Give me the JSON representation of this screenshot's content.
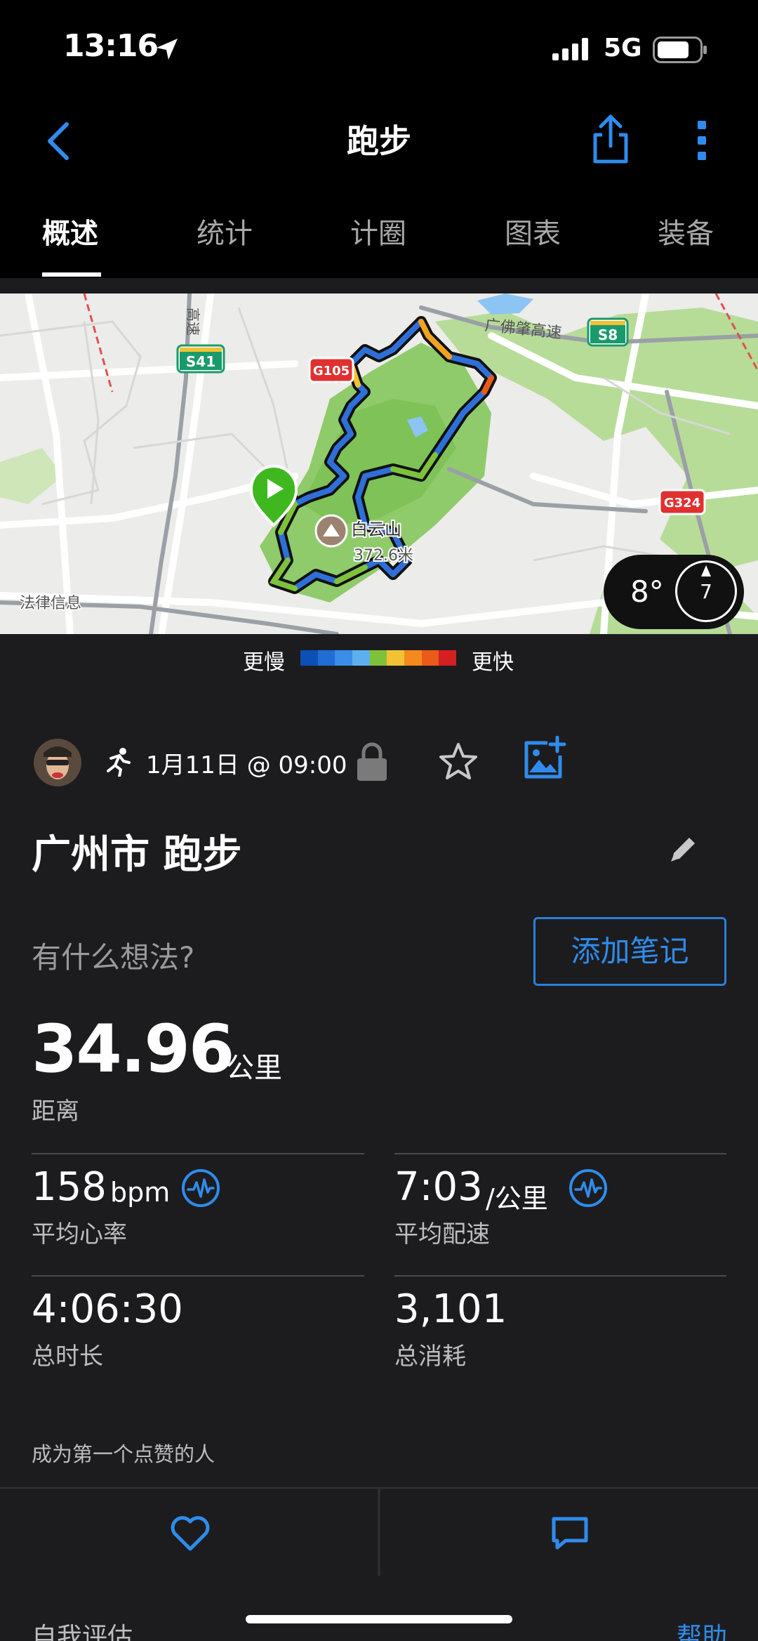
{
  "status_bar": {
    "time": "13:16",
    "network": "5G"
  },
  "nav": {
    "title": "跑步"
  },
  "tabs": [
    {
      "label": "概述",
      "active": true
    },
    {
      "label": "统计",
      "active": false
    },
    {
      "label": "计圈",
      "active": false
    },
    {
      "label": "图表",
      "active": false
    },
    {
      "label": "装备",
      "active": false
    }
  ],
  "map": {
    "road_labels": {
      "s41": "S41",
      "g105": "G105",
      "s8": "S8",
      "g324": "G324",
      "expressway": "广佛肇高速",
      "su": "高速"
    },
    "poi_name": "白云山",
    "poi_elevation": "372.6米",
    "corner_text": "法律信息",
    "weather_temp": "8°",
    "weather_num": "7"
  },
  "legend": {
    "slower": "更慢",
    "faster": "更快",
    "colors": [
      "#0c4fb5",
      "#1e6ed3",
      "#3a8ee8",
      "#5cb0f0",
      "#7fc23a",
      "#f2c232",
      "#f28a1e",
      "#ea5a1a",
      "#d42020"
    ]
  },
  "activity": {
    "date": "1月11日 @ 09:00",
    "title": "广州市 跑步",
    "thoughts_placeholder": "有什么想法?",
    "add_note": "添加笔记"
  },
  "stats": {
    "distance": {
      "value": "34.96",
      "unit": "公里",
      "label": "距离"
    },
    "heart_rate": {
      "value": "158",
      "unit": "bpm",
      "label": "平均心率"
    },
    "pace": {
      "value": "7:03",
      "unit": "/公里",
      "label": "平均配速"
    },
    "duration": {
      "value": "4:06:30",
      "label": "总时长"
    },
    "calories": {
      "value": "3,101",
      "label": "总消耗"
    }
  },
  "likes_text": "成为第一个点赞的人",
  "footer": {
    "self_eval": "自我评估",
    "help": "帮助"
  },
  "colors": {
    "accent": "#2f8cec",
    "background": "#1c1c1e"
  }
}
